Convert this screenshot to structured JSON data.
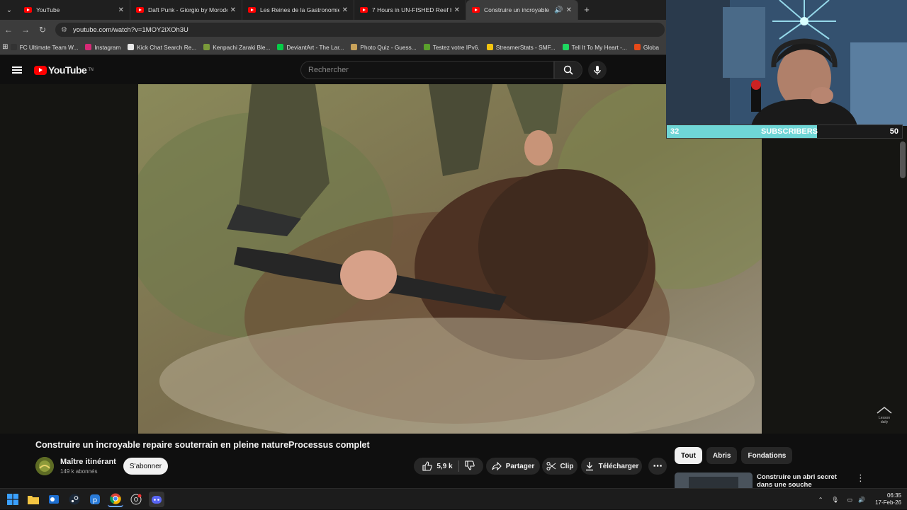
{
  "browser": {
    "tabs": [
      {
        "title": "YouTube",
        "active": false
      },
      {
        "title": "Daft Punk - Giorgio by Moroder",
        "active": false
      },
      {
        "title": "Les Reines de la Gastronomie d",
        "active": false
      },
      {
        "title": "7 Hours in UN-FISHED Reef Ho",
        "active": false
      },
      {
        "title": "Construire un incroyable re",
        "active": true
      }
    ],
    "new_tab": "+",
    "url": "youtube.com/watch?v=1MOY2iXOh3U",
    "bookmarks": [
      {
        "label": "FC Ultimate Team W...",
        "color": "#333333"
      },
      {
        "label": "Instagram",
        "color": "#d62976"
      },
      {
        "label": "Kick Chat Search Re...",
        "color": "#e8e8e8"
      },
      {
        "label": "Kenpachi Zaraki Ble...",
        "color": "#7a9a3a"
      },
      {
        "label": "DeviantArt - The Lar...",
        "color": "#05cc47"
      },
      {
        "label": "Photo Quiz - Guess...",
        "color": "#c8a25a"
      },
      {
        "label": "Testez votre IPv6.",
        "color": "#5aa02c"
      },
      {
        "label": "StreamerStats - SMF...",
        "color": "#f2c40f"
      },
      {
        "label": "Tell It To My Heart -...",
        "color": "#1ed760"
      },
      {
        "label": "Globa",
        "color": "#e64a19"
      }
    ]
  },
  "youtube": {
    "logo_text": "YouTube",
    "logo_region": "TN",
    "search_placeholder": "Rechercher"
  },
  "video": {
    "title": "Construire un incroyable repaire souterrain en pleine natureProcessus complet",
    "channel_name": "Maître itinérant",
    "channel_subs": "149 k abonnés",
    "subscribe_label": "S'abonner",
    "likes": "5,9 k",
    "share_label": "Partager",
    "clip_label": "Clip",
    "download_label": "Télécharger",
    "more_label": "⋯",
    "watermark": "Lesson daily"
  },
  "sidebar": {
    "chips": [
      {
        "label": "Tout",
        "selected": true
      },
      {
        "label": "Abris",
        "selected": false
      },
      {
        "label": "Fondations",
        "selected": false
      }
    ],
    "recommendation_title": "Construire un abri secret dans une souche d'arbreSurvie"
  },
  "overlay": {
    "sub_current": "32",
    "sub_label": "SUBSCRIBERS",
    "sub_goal": "50",
    "sub_progress": 0.64
  },
  "taskbar": {
    "time": "06:35",
    "date": "17-Feb-26"
  },
  "colors": {
    "accent": "#ff0000",
    "subbar": "#6fd6d6"
  }
}
